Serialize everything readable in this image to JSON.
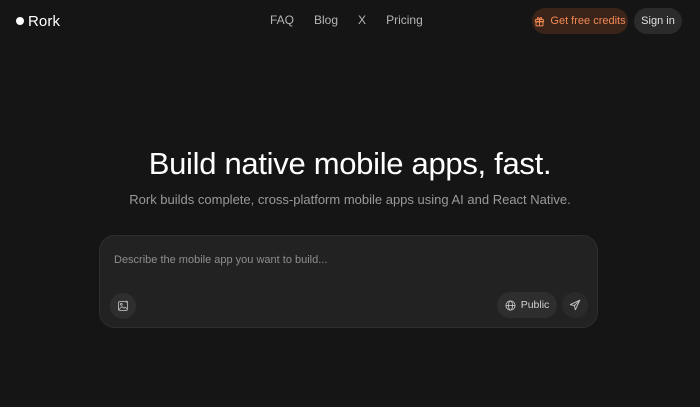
{
  "header": {
    "logo_text": "Rork",
    "nav": [
      {
        "label": "FAQ"
      },
      {
        "label": "Blog"
      },
      {
        "label": "X"
      },
      {
        "label": "Pricing"
      }
    ],
    "credits_label": "Get free credits",
    "signin_label": "Sign in"
  },
  "hero": {
    "title": "Build native mobile apps, fast.",
    "subtitle": "Rork builds complete, cross-platform mobile apps using AI and React Native."
  },
  "prompt": {
    "placeholder": "Describe the mobile app you want to build...",
    "value": "",
    "visibility_label": "Public"
  },
  "colors": {
    "background": "#151515",
    "accent": "#f28a55"
  },
  "icons": {
    "logo": "dot",
    "credits": "gift-icon",
    "attach": "image-icon",
    "visibility": "globe-icon",
    "send": "send-icon"
  }
}
